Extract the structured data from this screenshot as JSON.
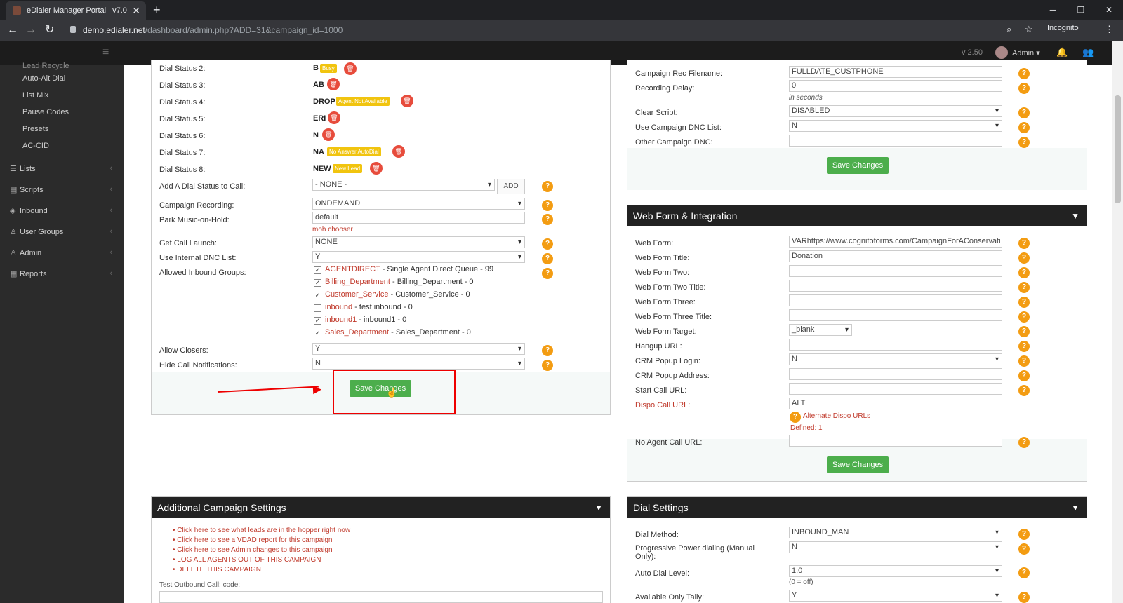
{
  "browser": {
    "tab_title": "eDialer Manager Portal | v7.0",
    "tab_close": "✕",
    "new_tab": "+",
    "url_host": "demo.edialer.net",
    "url_path": "/dashboard/admin.php?ADD=31&campaign_id=1000",
    "incognito_label": "Incognito"
  },
  "header": {
    "version": "v 2.50",
    "user": "Admin ▾"
  },
  "sidebar": {
    "sub_items": [
      "Lead Recycle",
      "Auto-Alt Dial",
      "List Mix",
      "Pause Codes",
      "Presets",
      "AC-CID"
    ],
    "main_items": [
      {
        "label": "Lists",
        "icon": "list-icon"
      },
      {
        "label": "Scripts",
        "icon": "script-icon"
      },
      {
        "label": "Inbound",
        "icon": "inbound-icon"
      },
      {
        "label": "User Groups",
        "icon": "user-groups-icon"
      },
      {
        "label": "Admin",
        "icon": "admin-icon"
      },
      {
        "label": "Reports",
        "icon": "reports-icon"
      }
    ]
  },
  "left_panel": {
    "dial_statuses": [
      {
        "label": "Dial Status 2:",
        "code": "B",
        "badge": "Busy"
      },
      {
        "label": "Dial Status 3:",
        "code": "AB",
        "badge": ""
      },
      {
        "label": "Dial Status 4:",
        "code": "DROP",
        "badge": "Agent Not Available"
      },
      {
        "label": "Dial Status 5:",
        "code": "ERI",
        "badge": ""
      },
      {
        "label": "Dial Status 6:",
        "code": "N",
        "badge": ""
      },
      {
        "label": "Dial Status 7:",
        "code": "NA",
        "badge": "No Answer AutoDial"
      },
      {
        "label": "Dial Status 8:",
        "code": "NEW",
        "badge": "New Lead"
      }
    ],
    "add_dial_status_label": "Add A Dial Status to Call:",
    "add_dial_status_value": "- NONE -",
    "add_button": "ADD",
    "campaign_recording_label": "Campaign Recording:",
    "campaign_recording_value": "ONDEMAND",
    "park_music_label": "Park Music-on-Hold:",
    "park_music_value": "default",
    "moh_chooser": "moh chooser",
    "get_call_launch_label": "Get Call Launch:",
    "get_call_launch_value": "NONE",
    "use_internal_dnc_label": "Use Internal DNC List:",
    "use_internal_dnc_value": "Y",
    "allowed_inbound_label": "Allowed Inbound Groups:",
    "inbound_groups": [
      {
        "code": "AGENTDIRECT",
        "desc": " - Single Agent Direct Queue - 99",
        "checked": true
      },
      {
        "code": "Billing_Department",
        "desc": " - Billing_Department - 0",
        "checked": true
      },
      {
        "code": "Customer_Service",
        "desc": " - Customer_Service - 0",
        "checked": true
      },
      {
        "code": "inbound",
        "desc": " - test inbound - 0",
        "checked": false
      },
      {
        "code": "inbound1",
        "desc": " - inbound1 - 0",
        "checked": true
      },
      {
        "code": "Sales_Department",
        "desc": " - Sales_Department - 0",
        "checked": true
      }
    ],
    "allow_closers_label": "Allow Closers:",
    "allow_closers_value": "Y",
    "hide_call_notif_label": "Hide Call Notifications:",
    "hide_call_notif_value": "N",
    "save_button": "Save Changes"
  },
  "right_top_panel": {
    "rec_filename_label": "Campaign Rec Filename:",
    "rec_filename_value": "FULLDATE_CUSTPHONE",
    "recording_delay_label": "Recording Delay:",
    "recording_delay_value": "0",
    "in_seconds": "in seconds",
    "clear_script_label": "Clear Script:",
    "clear_script_value": "DISABLED",
    "use_campaign_dnc_label": "Use Campaign DNC List:",
    "use_campaign_dnc_value": "N",
    "other_campaign_dnc_label": "Other Campaign DNC:",
    "other_campaign_dnc_value": "",
    "save_button": "Save Changes"
  },
  "web_form_panel": {
    "title": "Web Form & Integration",
    "web_form_label": "Web Form:",
    "web_form_value": "VARhttps://www.cognitoforms.com/CampaignForAConservati",
    "web_form_title_label": "Web Form Title:",
    "web_form_title_value": "Donation",
    "web_form_two_label": "Web Form Two:",
    "web_form_two_title_label": "Web Form Two Title:",
    "web_form_three_label": "Web Form Three:",
    "web_form_three_title_label": "Web Form Three Title:",
    "web_form_target_label": "Web Form Target:",
    "web_form_target_value": "_blank",
    "hangup_url_label": "Hangup URL:",
    "crm_popup_login_label": "CRM Popup Login:",
    "crm_popup_login_value": "N",
    "crm_popup_address_label": "CRM Popup Address:",
    "start_call_url_label": "Start Call URL:",
    "dispo_call_url_label": "Dispo Call URL:",
    "dispo_call_url_value": "ALT",
    "alternate_dispo": "Alternate Dispo URLs",
    "defined": "Defined: 1",
    "no_agent_call_url_label": "No Agent Call URL:",
    "save_button": "Save Changes"
  },
  "additional_panel": {
    "title": "Additional Campaign Settings",
    "links": [
      "Click here to see what leads are in the hopper right now",
      "Click here to see a VDAD report for this campaign",
      "Click here to see Admin changes to this campaign",
      "LOG ALL AGENTS OUT OF THIS CAMPAIGN",
      "DELETE THIS CAMPAIGN"
    ],
    "test_outbound_label": "Test Outbound Call: code:"
  },
  "dial_settings_panel": {
    "title": "Dial Settings",
    "dial_method_label": "Dial Method:",
    "dial_method_value": "INBOUND_MAN",
    "progressive_label": "Progressive Power dialing (Manual Only):",
    "progressive_value": "N",
    "auto_dial_label": "Auto Dial Level:",
    "auto_dial_value": "1.0",
    "auto_dial_note": "(0 = off)",
    "available_only_label": "Available Only Tally:",
    "available_only_value": "Y"
  },
  "help_glyph": "?",
  "delete_glyph": "🗑"
}
